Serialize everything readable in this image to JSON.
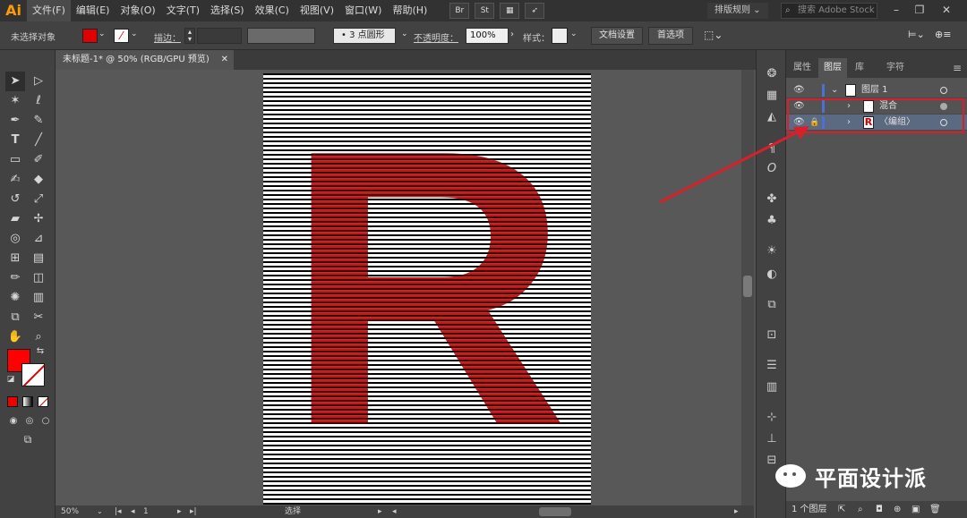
{
  "app": {
    "logo": "Ai"
  },
  "menu": {
    "items": [
      "文件(F)",
      "编辑(E)",
      "对象(O)",
      "文字(T)",
      "选择(S)",
      "效果(C)",
      "视图(V)",
      "窗口(W)",
      "帮助(H)"
    ],
    "bridge_icon": "Br",
    "stock_icon": "St",
    "workspace": "排版规则",
    "search_placeholder": "搜索 Adobe Stock"
  },
  "control": {
    "selection_state": "未选择对象",
    "stroke_label": "描边：",
    "brush": "3 点圆形",
    "opacity_label": "不透明度：",
    "opacity_value": "100%",
    "style_label": "样式：",
    "doc_setup_button": "文档设置",
    "preferences_button": "首选项",
    "fill_color": "#e00000"
  },
  "document": {
    "tab_title": "未标题-1* @ 50% (RGB/GPU 预览)",
    "artwork_letter": "R",
    "artwork_color": "#c41818"
  },
  "status": {
    "zoom": "50%",
    "page": "1",
    "tool": "选择"
  },
  "panel": {
    "tabs": [
      "属性",
      "图层",
      "库",
      "字符"
    ],
    "active_tab": "图层",
    "layers": [
      {
        "name": "图层 1"
      },
      {
        "name": "混合"
      },
      {
        "name": "〈编组〉",
        "thumb_letter": "R"
      }
    ],
    "footer_count": "1 个图层"
  },
  "watermark": {
    "text": "平面设计派"
  },
  "colors": {
    "accent_red": "#d8202c",
    "layer_color": "#4e6fd6",
    "selection_row": "#5b6a80"
  }
}
